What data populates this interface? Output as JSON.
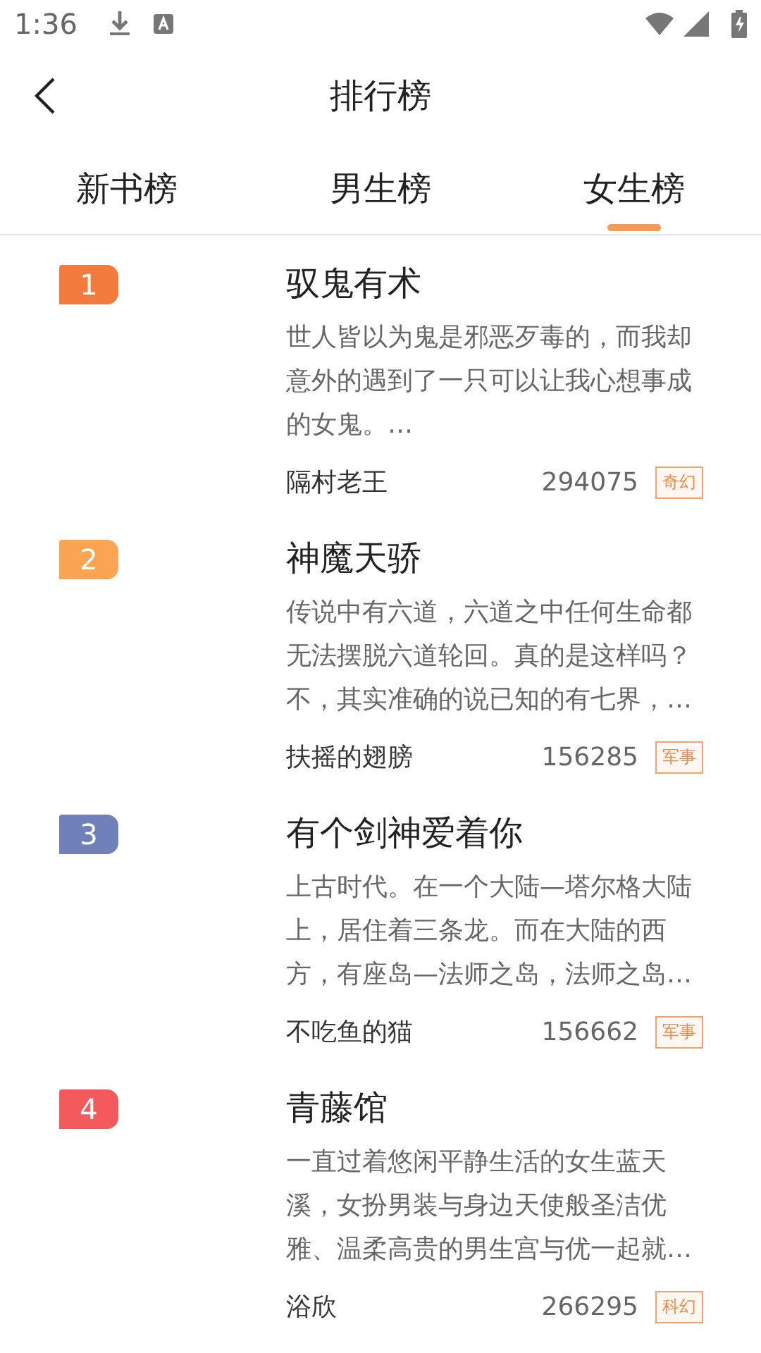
{
  "status_bar": {
    "time": "1:36"
  },
  "header": {
    "title": "排行榜"
  },
  "tabs": [
    {
      "label": "新书榜",
      "selected": false
    },
    {
      "label": "男生榜",
      "selected": false
    },
    {
      "label": "女生榜",
      "selected": true
    }
  ],
  "books": [
    {
      "rank": "1",
      "color": "#f47b3e",
      "title": "驭鬼有术",
      "description": "世人皆以为鬼是邪恶歹毒的，而我却意外的遇到了一只可以让我心想事成的女鬼。…",
      "author": "隔村老王",
      "count": "294075",
      "tag": "奇幻"
    },
    {
      "rank": "2",
      "color": "#fba552",
      "title": "神魔天骄",
      "description": "传说中有六道，六道之中任何生命都无法摆脱六道轮回。真的是这样吗？不，其实准确的说已知的有七界，…",
      "author": "扶摇的翅膀",
      "count": "156285",
      "tag": "军事"
    },
    {
      "rank": "3",
      "color": "#7080b8",
      "title": "有个剑神爱着你",
      "description": "上古时代。在一个大陆—塔尔格大陆上，居住着三条龙。而在大陆的西方，有座岛—法师之岛，法师之岛…",
      "author": "不吃鱼的猫",
      "count": "156662",
      "tag": "军事"
    },
    {
      "rank": "4",
      "color": "#f25a5e",
      "title": "青藤馆",
      "description": "一直过着悠闲平静生活的女生蓝天溪，女扮男装与身边天使般圣洁优雅、温柔高贵的男生宫与优一起就…",
      "author": "浴欣",
      "count": "266295",
      "tag": "科幻"
    }
  ]
}
